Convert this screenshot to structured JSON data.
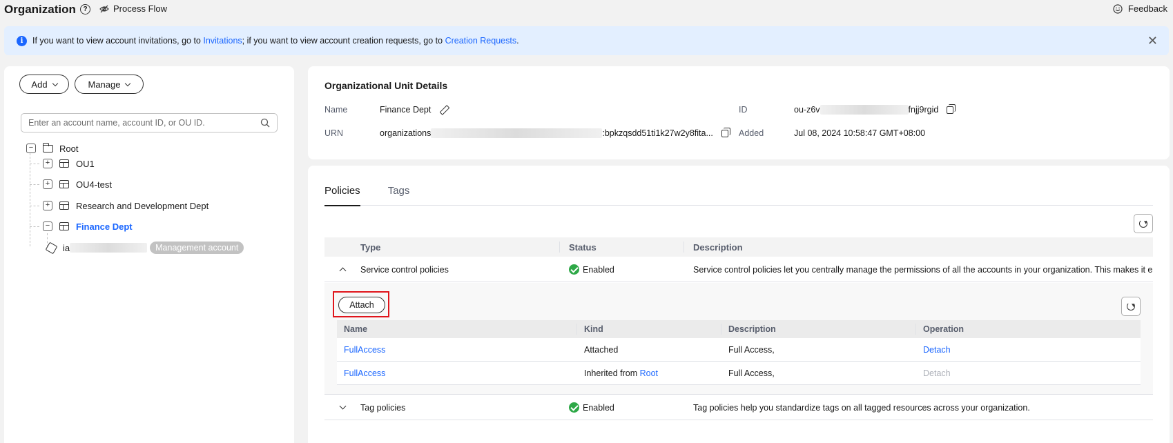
{
  "header": {
    "title": "Organization",
    "help_glyph": "?",
    "process_flow": "Process Flow",
    "feedback": "Feedback"
  },
  "banner": {
    "text_1": "If you want to view account invitations, go to ",
    "link_invitations": "Invitations",
    "text_2": "; if you want to view account creation requests, go to ",
    "link_creation": "Creation Requests",
    "text_3": ".",
    "info_glyph": "i",
    "close_glyph": "✕"
  },
  "left": {
    "add_label": "Add",
    "manage_label": "Manage",
    "search_placeholder": "Enter an account name, account ID, or OU ID.",
    "tree": {
      "root": "Root",
      "items": [
        "OU1",
        "OU4-test",
        "Research and Development Dept",
        "Finance Dept"
      ],
      "account_prefix": "ia",
      "account_badge": "Management account"
    },
    "expand_glyph": "+",
    "collapse_glyph": "−"
  },
  "details": {
    "title": "Organizational Unit Details",
    "name_label": "Name",
    "name_value": "Finance Dept",
    "urn_label": "URN",
    "urn_prefix": "organizations",
    "urn_suffix": ":bpkzqsdd51ti1k27w2y8fita...",
    "id_label": "ID",
    "id_prefix": "ou-z6v",
    "id_suffix": "fnjj9rgid",
    "added_label": "Added",
    "added_value": "Jul 08, 2024 10:58:47 GMT+08:00"
  },
  "tabs": [
    "Policies",
    "Tags"
  ],
  "policy_grid": {
    "columns": [
      "Type",
      "Status",
      "Description"
    ],
    "rows": [
      {
        "type": "Service control policies",
        "status": "Enabled",
        "description": "Service control policies let you centrally manage the permissions of all the accounts in your organization. This makes it ea..."
      },
      {
        "type": "Tag policies",
        "status": "Enabled",
        "description": "Tag policies help you standardize tags on all tagged resources across your organization."
      }
    ]
  },
  "attached": {
    "attach_label": "Attach",
    "columns": [
      "Name",
      "Kind",
      "Description",
      "Operation"
    ],
    "rows": [
      {
        "name": "FullAccess",
        "kind": "Attached",
        "kind_link": "",
        "description": "Full Access,",
        "operation": "Detach"
      },
      {
        "name": "FullAccess",
        "kind": "Inherited from ",
        "kind_link": "Root",
        "description": "Full Access,",
        "operation": "Detach"
      }
    ]
  },
  "colors": {
    "accent": "#1a66ff",
    "success": "#2ea847",
    "highlight": "#e0141b",
    "banner_bg": "#e3efff"
  }
}
